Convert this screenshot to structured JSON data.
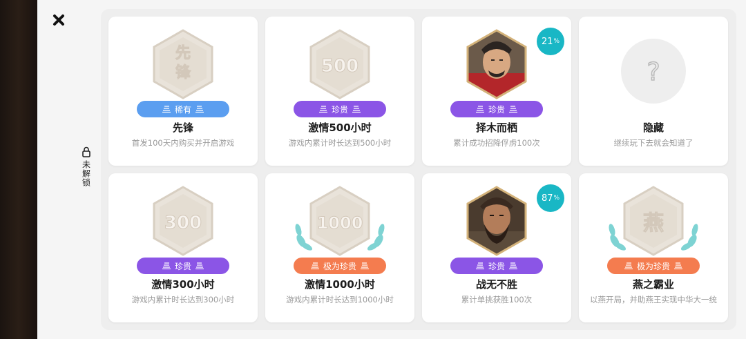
{
  "side_label": "未解锁",
  "achievements": [
    {
      "title": "先锋",
      "desc": "首发100天内购买并开启游戏",
      "rarity": "稀有",
      "rarity_color": "#5b9ef0",
      "medal_text": "先锋",
      "medal_type": "stone"
    },
    {
      "title": "激情500小时",
      "desc": "游戏内累计时长达到500小时",
      "rarity": "珍贵",
      "rarity_color": "#8b55e6",
      "medal_text": "500",
      "medal_type": "stone"
    },
    {
      "title": "择木而栖",
      "desc": "累计成功招降俘虏100次",
      "rarity": "珍贵",
      "rarity_color": "#8b55e6",
      "medal_type": "portrait",
      "percent": "21",
      "percent_unit": "%"
    },
    {
      "title": "隐藏",
      "desc": "继续玩下去就会知道了",
      "medal_type": "hidden",
      "hidden_glyph": "?"
    },
    {
      "title": "激情300小时",
      "desc": "游戏内累计时长达到300小时",
      "rarity": "珍贵",
      "rarity_color": "#8b55e6",
      "medal_text": "300",
      "medal_type": "stone"
    },
    {
      "title": "激情1000小时",
      "desc": "游戏内累计时长达到1000小时",
      "rarity": "极为珍贵",
      "rarity_color": "#f47c4f",
      "medal_text": "1000",
      "medal_type": "laurel"
    },
    {
      "title": "战无不胜",
      "desc": "累计单挑获胜100次",
      "rarity": "珍贵",
      "rarity_color": "#8b55e6",
      "medal_type": "portrait2",
      "percent": "87",
      "percent_unit": "%"
    },
    {
      "title": "燕之霸业",
      "desc": "以燕开局，并助燕王实现中华大一统",
      "rarity": "极为珍贵",
      "rarity_color": "#f47c4f",
      "medal_text": "燕",
      "medal_type": "laurel"
    }
  ]
}
